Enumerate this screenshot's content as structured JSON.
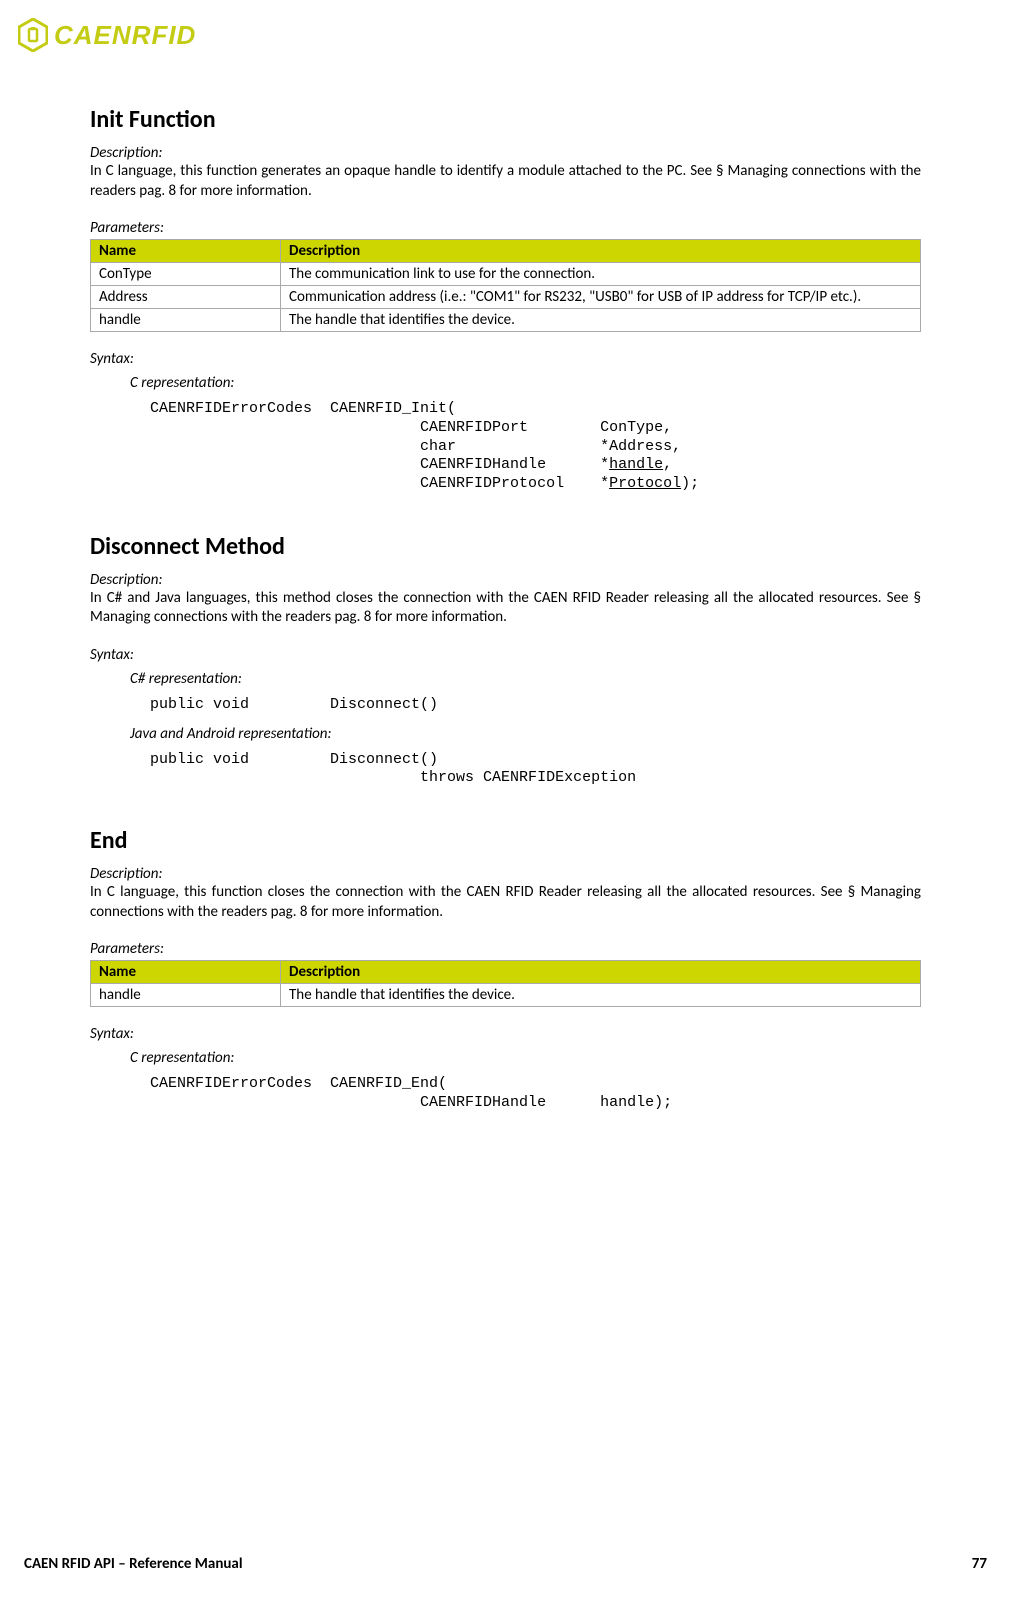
{
  "brand": "CAENRFID",
  "sections": [
    {
      "title": "Init Function",
      "desc_label": "Description:",
      "desc": "In C language, this function generates an opaque handle to identify a module attached to the PC. See § Managing connections with the readers pag. 8 for more information.",
      "params_label": "Parameters:",
      "params_header_name": "Name",
      "params_header_desc": "Description",
      "params": [
        {
          "name": "ConType",
          "desc": "The communication link to use for the connection."
        },
        {
          "name": "Address",
          "desc": "Communication address (i.e.: \"COM1\" for RS232, \"USB0\" for USB of IP address for TCP/IP etc.)."
        },
        {
          "name": "handle",
          "desc": "The handle that identifies the device."
        }
      ],
      "syntax_label": "Syntax:",
      "repr_c": "C representation:",
      "code_c_line1": "CAENRFIDErrorCodes  CAENRFID_Init(",
      "code_c_line2": "                              CAENRFIDPort        ConType,",
      "code_c_line3": "                              char                *Address,",
      "code_c_line4": "                              CAENRFIDHandle      *",
      "code_c_line4_u": "handle",
      "code_c_line4_end": ",",
      "code_c_line5": "                              CAENRFIDProtocol    *",
      "code_c_line5_u": "Protocol",
      "code_c_line5_end": ");"
    },
    {
      "title": "Disconnect Method",
      "desc_label": "Description:",
      "desc": "In C# and Java languages, this method closes the connection with the CAEN RFID Reader releasing all the allocated resources. See § Managing connections with the readers pag. 8 for more information.",
      "syntax_label": "Syntax:",
      "repr_cs": "C# representation:",
      "code_cs": "public void         Disconnect()",
      "repr_java": "Java and Android representation:",
      "code_java": "public void         Disconnect()\n                              throws CAENRFIDException"
    },
    {
      "title": "End",
      "desc_label": "Description:",
      "desc": "In C language, this function closes the connection with the CAEN RFID Reader releasing all the allocated resources. See § Managing connections with the readers pag. 8 for more information.",
      "params_label": "Parameters:",
      "params_header_name": "Name",
      "params_header_desc": "Description",
      "params": [
        {
          "name": "handle",
          "desc": "The handle that identifies the device."
        }
      ],
      "syntax_label": "Syntax:",
      "repr_c": "C representation:",
      "code_c": "CAENRFIDErrorCodes  CAENRFID_End(\n                              CAENRFIDHandle      handle);"
    }
  ],
  "footer_left": "CAEN RFID API – Reference Manual",
  "footer_right": "77"
}
